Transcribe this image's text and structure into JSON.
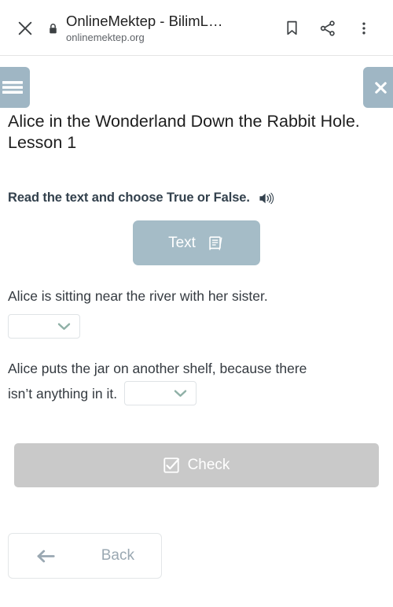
{
  "browser": {
    "close_icon": "close-icon",
    "lock_icon": "lock-icon",
    "title": "OnlineMektep - BilimL…",
    "host": "onlinemektep.org",
    "bookmark_icon": "bookmark-icon",
    "share_icon": "share-icon",
    "overflow_icon": "more-vertical-icon"
  },
  "page": {
    "menu_icon": "hamburger-menu-icon",
    "close_icon": "close-x-icon",
    "lesson_title": "Alice in the Wonderland Down the Rabbit Hole. Lesson 1",
    "instruction": "Read the text and choose True or False.",
    "audio_icon": "speaker-volume-icon",
    "text_button": {
      "label": "Text",
      "icon": "book-icon"
    },
    "questions": [
      {
        "text": "Alice is sitting near the river with her sister.",
        "answer": "",
        "dropdown_icon": "chevron-down-icon",
        "inline": false
      },
      {
        "text_line_1": "Alice puts the jar on another shelf, because there",
        "text_line_2": "isn’t anything in it.",
        "answer": "",
        "dropdown_icon": "chevron-down-icon",
        "inline": true
      }
    ],
    "check_button": {
      "label": "Check",
      "icon": "checkbox-checked-icon"
    },
    "back_button": {
      "label": "Back",
      "icon": "arrow-left-icon"
    }
  },
  "colors": {
    "accent_blue_gray": "#9fb6c4",
    "text_button_bg": "#a5bcc7",
    "check_disabled": "#c9c9c9",
    "dropdown_chevron": "#8fb0a6",
    "back_text": "#9aa8b2",
    "body_text": "#343a40",
    "heading": "#1d1d1d"
  }
}
